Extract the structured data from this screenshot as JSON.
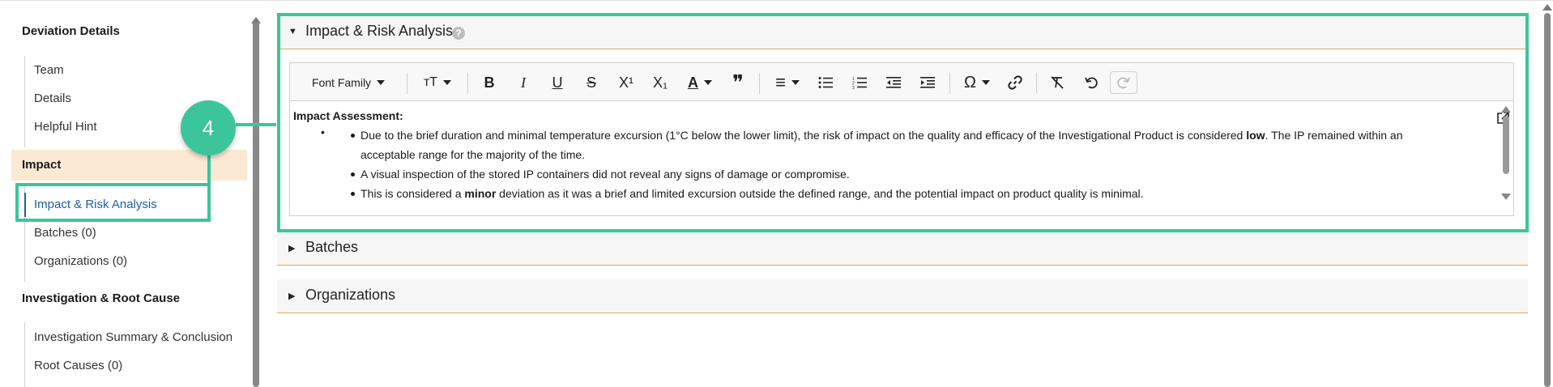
{
  "sidebar": {
    "section_deviation": "Deviation Details",
    "item_team": "Team",
    "item_details": "Details",
    "item_hint": "Helpful Hint",
    "section_impact": "Impact",
    "item_risk": "Impact & Risk Analysis",
    "item_batches": "Batches (0)",
    "item_orgs": "Organizations (0)",
    "section_investigation": "Investigation & Root Cause",
    "item_summary": "Investigation Summary & Conclusion",
    "item_root": "Root Causes (0)"
  },
  "annotation": {
    "step": "4"
  },
  "panels": {
    "risk": {
      "title": "Impact & Risk Analysis",
      "help": "?"
    },
    "batches": {
      "title": "Batches"
    },
    "orgs": {
      "title": "Organizations"
    }
  },
  "toolbar": {
    "font_family": "Font Family",
    "font_size": "тT",
    "bold": "B",
    "italic": "I",
    "underline": "U",
    "strike": "S",
    "superscript": "X¹",
    "subscript": "X₁",
    "font_color": "A",
    "quote": "❞",
    "align": "≡",
    "special_char": "Ω"
  },
  "editor": {
    "heading": "Impact Assessment:",
    "empty_bullet": "•",
    "b1_pre": "Due to the brief duration and minimal temperature excursion (1°C below the lower limit), the risk of impact on the quality and efficacy of the Investigational Product is considered ",
    "b1_bold": "low",
    "b1_post": ". The IP remained within an acceptable range for the majority of the time.",
    "b2": "A visual inspection of the stored IP containers did not reveal any signs of damage or compromise.",
    "b3_pre": "This is considered a ",
    "b3_bold": "minor",
    "b3_post": " deviation as it was a brief and limited excursion outside the defined range, and the potential impact on product quality is minimal."
  },
  "colors": {
    "accent": "#3cc59b",
    "active_link": "#1f5fa8",
    "header_underline": "#e8a35b",
    "impact_bg": "#fbe9d3"
  },
  "icons": [
    "help-icon",
    "bold-icon",
    "italic-icon",
    "underline-icon",
    "strikethrough-icon",
    "superscript-icon",
    "subscript-icon",
    "font-color-icon",
    "quote-icon",
    "align-icon",
    "bullet-list-icon",
    "numbered-list-icon",
    "outdent-icon",
    "indent-icon",
    "special-char-icon",
    "link-icon",
    "clear-format-icon",
    "undo-icon",
    "redo-icon",
    "expand-icon"
  ]
}
